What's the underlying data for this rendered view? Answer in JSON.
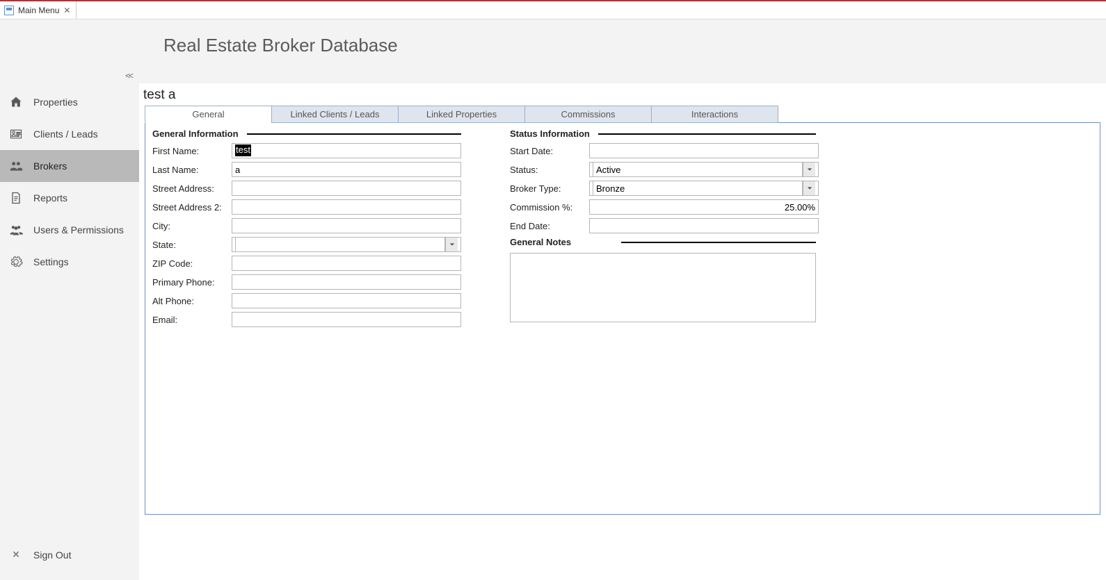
{
  "top_tab": {
    "label": "Main Menu"
  },
  "header": {
    "title": "Real Estate Broker Database",
    "collapse": "<<"
  },
  "sidebar": {
    "items": [
      {
        "label": "Properties"
      },
      {
        "label": "Clients / Leads"
      },
      {
        "label": "Brokers"
      },
      {
        "label": "Reports"
      },
      {
        "label": "Users & Permissions"
      },
      {
        "label": "Settings"
      }
    ],
    "active_index": 2,
    "sign_out": "Sign Out"
  },
  "record": {
    "title": "test a"
  },
  "detail_tabs": {
    "items": [
      {
        "label": "General"
      },
      {
        "label": "Linked Clients / Leads"
      },
      {
        "label": "Linked Properties"
      },
      {
        "label": "Commissions"
      },
      {
        "label": "Interactions"
      }
    ],
    "active_index": 0
  },
  "sections": {
    "general_info": "General Information",
    "status_info": "Status Information",
    "general_notes": "General Notes"
  },
  "form": {
    "labels": {
      "first_name": "First Name:",
      "last_name": "Last Name:",
      "street1": "Street Address:",
      "street2": "Street Address 2:",
      "city": "City:",
      "state": "State:",
      "zip": "ZIP Code:",
      "phone1": "Primary Phone:",
      "phone2": "Alt Phone:",
      "email": "Email:",
      "start_date": "Start Date:",
      "status": "Status:",
      "broker_type": "Broker Type:",
      "commission": "Commission %:",
      "end_date": "End Date:"
    },
    "values": {
      "first_name": "test",
      "last_name": "a",
      "street1": "",
      "street2": "",
      "city": "",
      "state": "",
      "zip": "",
      "phone1": "",
      "phone2": "",
      "email": "",
      "start_date": "",
      "status": "Active",
      "broker_type": "Bronze",
      "commission": "25.00%",
      "end_date": "",
      "notes": ""
    }
  }
}
